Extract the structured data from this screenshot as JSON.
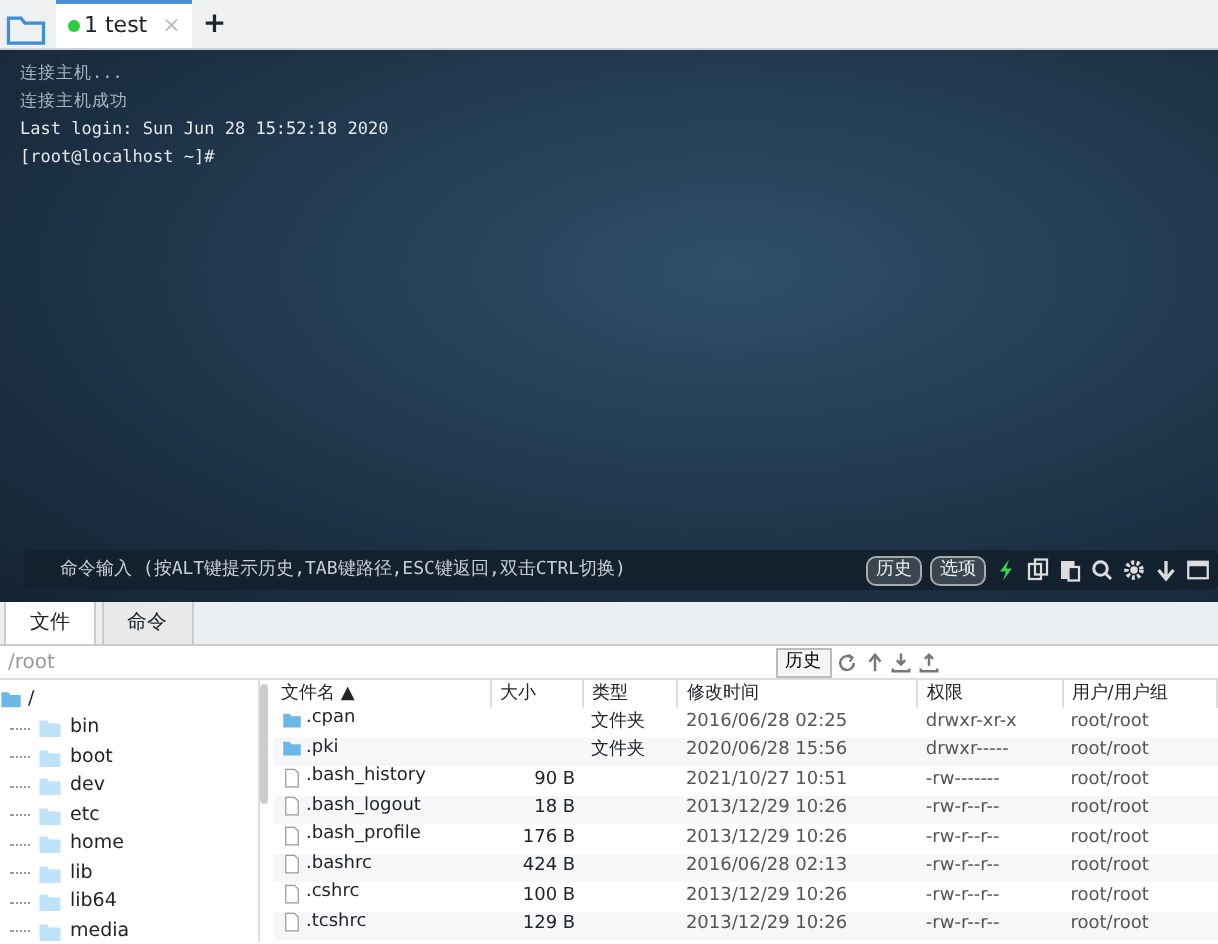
{
  "session_tabs": [
    {
      "label": "1 test",
      "selected": true,
      "connected": true,
      "close": "×"
    }
  ],
  "add_tab": "+",
  "terminal": {
    "lines": [
      "连接主机...",
      "连接主机成功",
      "Last login: Sun Jun 28 15:52:18 2020",
      "[root@localhost ~]#"
    ]
  },
  "command_bar": {
    "placeholder": "命令输入 (按ALT键提示历史,TAB键路径,ESC键返回,双击CTRL切换)",
    "buttons": [
      "历史",
      "选项"
    ]
  },
  "panel_tabs": [
    {
      "label": "文件",
      "selected": true
    },
    {
      "label": "命令",
      "selected": false
    }
  ],
  "path": {
    "value": "/root",
    "history_button": "历史"
  },
  "tree": {
    "label": "/",
    "children": [
      {
        "label": "bin"
      },
      {
        "label": "boot"
      },
      {
        "label": "dev"
      },
      {
        "label": "etc"
      },
      {
        "label": "home"
      },
      {
        "label": "lib"
      },
      {
        "label": "lib64"
      },
      {
        "label": "media"
      }
    ]
  },
  "file_table": {
    "columns": [
      "文件名 ▲",
      "大小",
      "类型",
      "修改时间",
      "权限",
      "用户/用户组"
    ],
    "rows": [
      {
        "kind": "folder",
        "name": ".cpan",
        "size": "",
        "type": "文件夹",
        "modified": "2016/06/28 02:25",
        "permissions": "drwxr-xr-x",
        "owner": "root/root"
      },
      {
        "kind": "folder",
        "name": ".pki",
        "size": "",
        "type": "文件夹",
        "modified": "2020/06/28 15:56",
        "permissions": "drwxr-----",
        "owner": "root/root"
      },
      {
        "kind": "file",
        "name": ".bash_history",
        "size": "90 B",
        "type": "",
        "modified": "2021/10/27 10:51",
        "permissions": "-rw-------",
        "owner": "root/root"
      },
      {
        "kind": "file",
        "name": ".bash_logout",
        "size": "18 B",
        "type": "",
        "modified": "2013/12/29 10:26",
        "permissions": "-rw-r--r--",
        "owner": "root/root"
      },
      {
        "kind": "file",
        "name": ".bash_profile",
        "size": "176 B",
        "type": "",
        "modified": "2013/12/29 10:26",
        "permissions": "-rw-r--r--",
        "owner": "root/root"
      },
      {
        "kind": "file",
        "name": ".bashrc",
        "size": "424 B",
        "type": "",
        "modified": "2016/06/28 02:13",
        "permissions": "-rw-r--r--",
        "owner": "root/root"
      },
      {
        "kind": "file",
        "name": ".cshrc",
        "size": "100 B",
        "type": "",
        "modified": "2013/12/29 10:26",
        "permissions": "-rw-r--r--",
        "owner": "root/root"
      },
      {
        "kind": "file",
        "name": ".tcshrc",
        "size": "129 B",
        "type": "",
        "modified": "2013/12/29 10:26",
        "permissions": "-rw-r--r--",
        "owner": "root/root"
      }
    ]
  }
}
